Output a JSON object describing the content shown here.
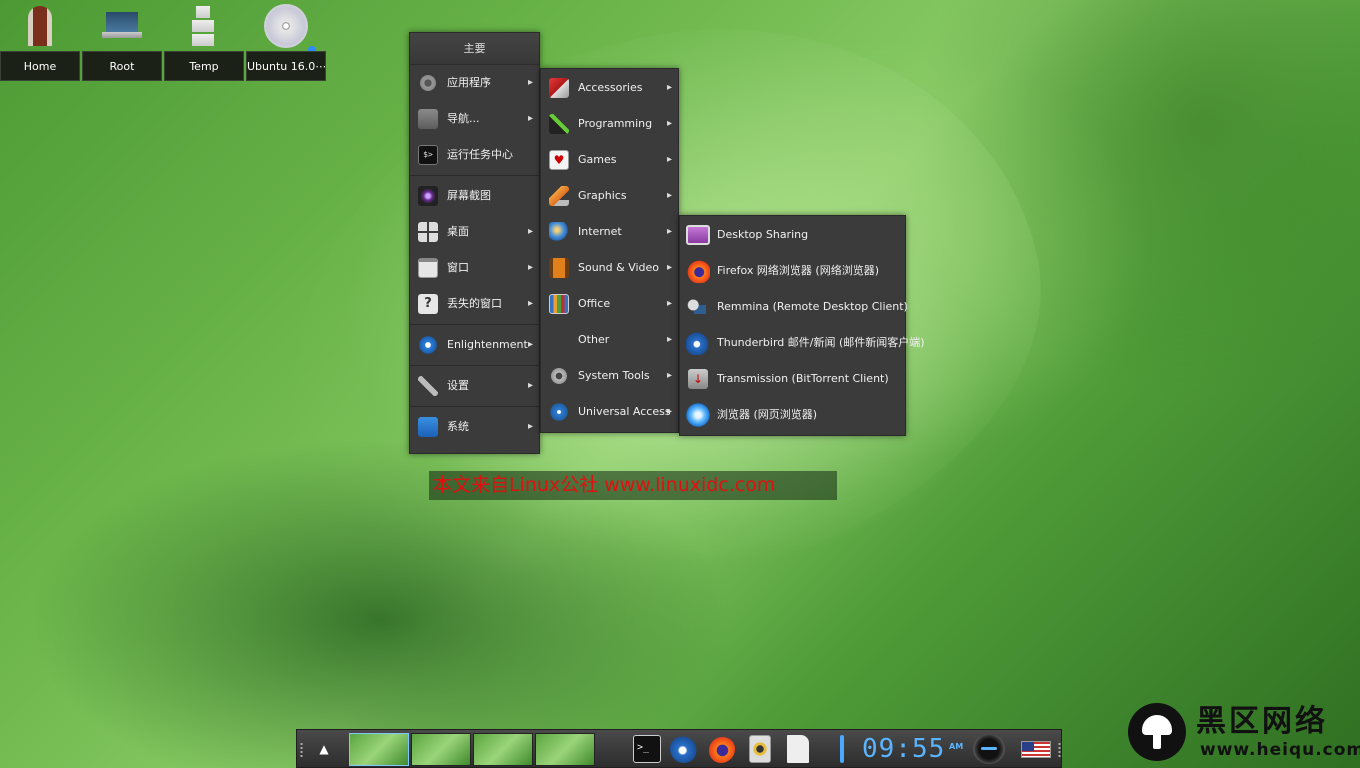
{
  "desktop_icons": [
    {
      "label": "Home",
      "icon": "door-icon"
    },
    {
      "label": "Root",
      "icon": "laptop-icon"
    },
    {
      "label": "Temp",
      "icon": "boxes-icon"
    },
    {
      "label": "Ubuntu 16.0⋯",
      "icon": "cd-icon"
    }
  ],
  "main_menu": {
    "title": "主要",
    "items": [
      {
        "label": "应用程序",
        "icon": "gear-icon",
        "submenu": true
      },
      {
        "label": "导航...",
        "icon": "folder-icon",
        "submenu": true
      },
      {
        "label": "运行任务中心",
        "icon": "terminal-icon",
        "submenu": false
      },
      {
        "label": "屏幕截图",
        "icon": "screenshot-icon",
        "submenu": false
      },
      {
        "label": "桌面",
        "icon": "desktop-grid-icon",
        "submenu": true
      },
      {
        "label": "窗口",
        "icon": "window-icon",
        "submenu": true
      },
      {
        "label": "丢失的窗口",
        "icon": "question-icon",
        "submenu": true
      },
      {
        "label": "Enlightenment",
        "icon": "enlightenment-icon",
        "submenu": true
      },
      {
        "label": "设置",
        "icon": "wrench-icon",
        "submenu": true
      },
      {
        "label": "系统",
        "icon": "system-icon",
        "submenu": true
      }
    ]
  },
  "apps_menu": {
    "items": [
      {
        "label": "Accessories",
        "icon": "accessories-icon"
      },
      {
        "label": "Programming",
        "icon": "programming-icon"
      },
      {
        "label": "Games",
        "icon": "games-icon"
      },
      {
        "label": "Graphics",
        "icon": "graphics-icon"
      },
      {
        "label": "Internet",
        "icon": "internet-icon"
      },
      {
        "label": "Sound & Video",
        "icon": "sound-video-icon"
      },
      {
        "label": "Office",
        "icon": "office-icon"
      },
      {
        "label": "Other",
        "icon": ""
      },
      {
        "label": "System Tools",
        "icon": "system-tools-icon"
      },
      {
        "label": "Universal Access",
        "icon": "universal-access-icon"
      }
    ]
  },
  "internet_menu": {
    "items": [
      {
        "label": "Desktop Sharing",
        "icon": "desktop-sharing-icon"
      },
      {
        "label": "Firefox 网络浏览器 (网络浏览器)",
        "icon": "firefox-icon"
      },
      {
        "label": "Remmina (Remote Desktop Client)",
        "icon": "remmina-icon"
      },
      {
        "label": "Thunderbird 邮件/新闻 (邮件新闻客户端)",
        "icon": "thunderbird-icon"
      },
      {
        "label": "Transmission (BitTorrent Client)",
        "icon": "transmission-icon"
      },
      {
        "label": "浏览器 (网页浏览器)",
        "icon": "browser-icon"
      }
    ]
  },
  "watermark": "本文来自Linux公社 www.linuxidc.com",
  "taskbar": {
    "up_arrow": "▲",
    "clock": "09:55",
    "ampm": "AM",
    "launchers": [
      "terminal-icon",
      "thunderbird-icon",
      "firefox-icon",
      "media-player-icon",
      "document-icon"
    ]
  },
  "brand": {
    "name": "黑区网络",
    "url": "www.heiqu.com"
  },
  "colors": {
    "menu_bg": "#3b3b3b",
    "clock": "#5ab4ff",
    "watermark": "#e01010"
  }
}
